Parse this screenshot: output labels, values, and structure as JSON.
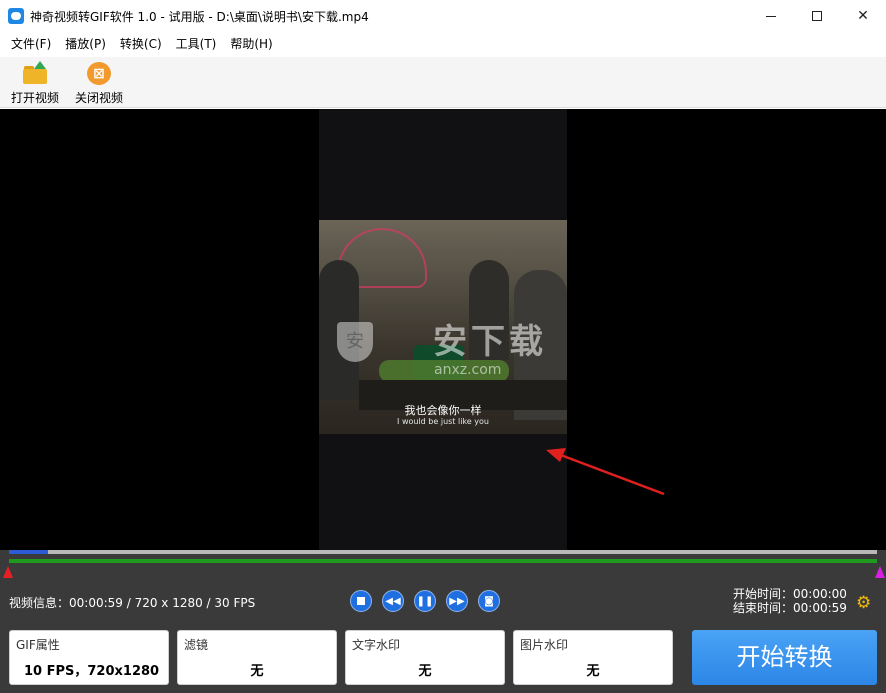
{
  "window": {
    "title": "神奇视频转GIF软件 1.0 - 试用版 - D:\\桌面\\说明书\\安下载.mp4"
  },
  "menu": [
    "文件(F)",
    "播放(P)",
    "转换(C)",
    "工具(T)",
    "帮助(H)"
  ],
  "toolbar": {
    "open_label": "打开视频",
    "close_label": "关闭视频"
  },
  "video": {
    "subtitle_cn": "我也会像你一样",
    "subtitle_en": "I would be just like you",
    "watermark": "安下载",
    "watermark_sub": "anxz.com"
  },
  "playback": {
    "progress": 0.045
  },
  "info": {
    "video_info": "视频信息：00:00:59 / 720 x 1280 / 30 FPS",
    "start_time": "开始时间：00:00:00",
    "end_time": "结束时间：00:00:59"
  },
  "options": {
    "gif_title": "GIF属性",
    "gif_value": "10 FPS，720x1280",
    "filter_title": "滤镜",
    "filter_value": "无",
    "text_wm_title": "文字水印",
    "text_wm_value": "无",
    "image_wm_title": "图片水印",
    "image_wm_value": "无"
  },
  "start_button": "开始转换",
  "colors": {
    "accent": "#2c86e6",
    "progress": "#2d5bd6",
    "trim": "#1f9a1f",
    "trim_start": "#e81e25",
    "trim_end": "#d81ee0",
    "gear": "#f2b90e"
  }
}
